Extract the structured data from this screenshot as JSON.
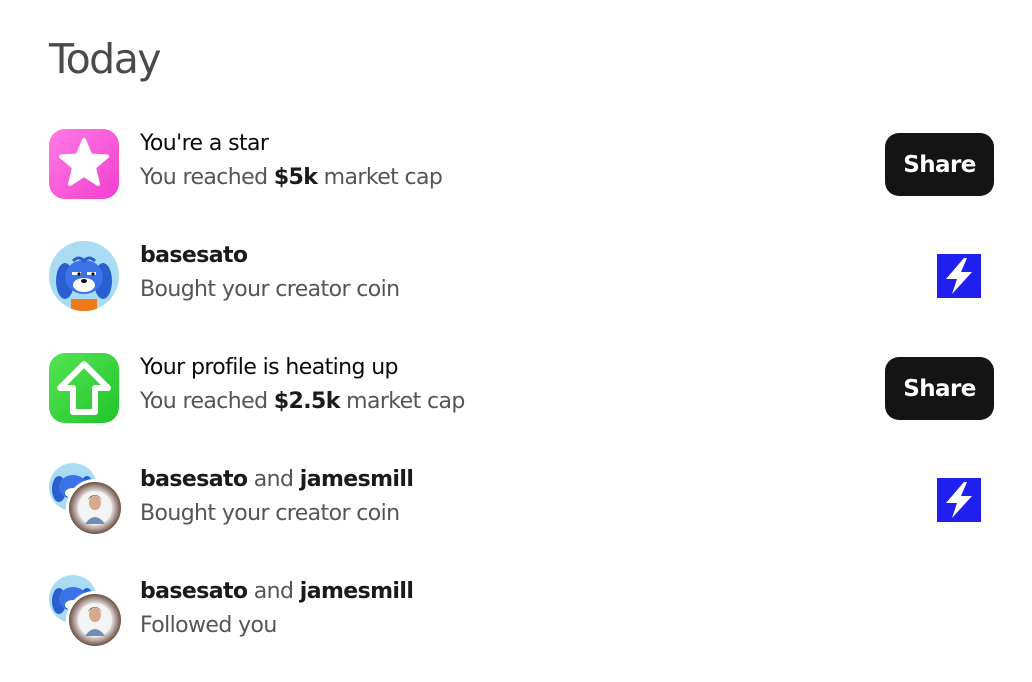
{
  "section": {
    "title": "Today"
  },
  "colors": {
    "share_button_bg": "#141414",
    "bolt_blue": "#1f1ff0",
    "star_pink": "#ff4fd8",
    "heat_green": "#36d63a"
  },
  "notifications": [
    {
      "icon": "star-icon",
      "title": "You're a star",
      "subtitle_prefix": "You reached ",
      "subtitle_value": "$5k",
      "subtitle_suffix": " market cap",
      "action": {
        "type": "button",
        "label": "Share"
      }
    },
    {
      "icon": "basesato-avatar",
      "title": "basesato",
      "subtitle": "Bought your creator coin",
      "action": {
        "type": "icon",
        "icon": "lightning-icon"
      }
    },
    {
      "icon": "arrow-up-icon",
      "title": "Your profile is heating up",
      "subtitle_prefix": "You reached ",
      "subtitle_value": "$2.5k",
      "subtitle_suffix": " market cap",
      "action": {
        "type": "button",
        "label": "Share"
      }
    },
    {
      "icon": "stacked-avatars",
      "user1": "basesato",
      "joiner": " and ",
      "user2": "jamesmill",
      "subtitle": "Bought your creator coin",
      "action": {
        "type": "icon",
        "icon": "lightning-icon"
      }
    },
    {
      "icon": "stacked-avatars",
      "user1": "basesato",
      "joiner": " and ",
      "user2": "jamesmill",
      "subtitle": "Followed you",
      "action": null
    }
  ]
}
